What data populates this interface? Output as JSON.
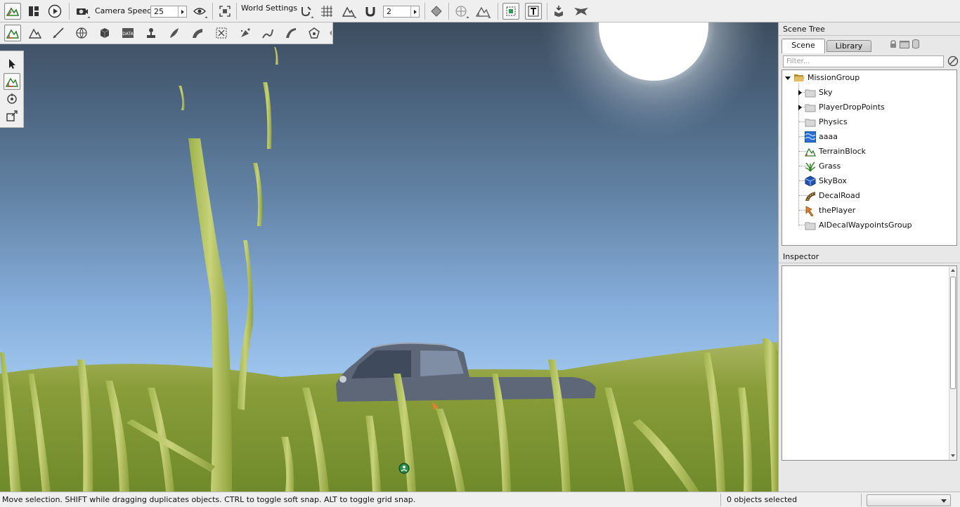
{
  "toolbar": {
    "camera_speed_label": "Camera Speed",
    "camera_speed_value": "25",
    "world_settings_label": "World Settings",
    "snap_value": "2",
    "buttons": [
      "editor-logo-icon",
      "layout-icon",
      "play-icon",
      "camera-icon",
      "visibility-eye-icon",
      "fit-view-icon",
      "snap-tool-icon",
      "grid-snap-icon",
      "terrain-snap-icon",
      "magnet-icon",
      "bounds-icon",
      "object-center-icon",
      "object-transform-icon",
      "select-box-icon",
      "text-label-icon",
      "drop-object-icon",
      "stamp-icon"
    ]
  },
  "editor_tools": [
    "world-editor-icon",
    "terrain-editor-icon",
    "terrain-painter-icon",
    "sketch-icon",
    "mesh-icon",
    "datablock-icon",
    "shape-editor-icon",
    "forest-editor-icon",
    "road-editor-icon",
    "decal-editor-icon",
    "particle-icon",
    "river-editor-icon",
    "mesh-road-icon",
    "convex-editor-icon"
  ],
  "palette": [
    "select-arrow-icon",
    "move-icon",
    "rotate-icon",
    "scale-icon"
  ],
  "scene_tree": {
    "title": "Scene Tree",
    "tabs": {
      "scene": "Scene",
      "library": "Library"
    },
    "filter_placeholder": "Filter...",
    "root": "MissionGroup",
    "items": [
      {
        "label": "Sky",
        "icon": "folder-icon",
        "expandable": true
      },
      {
        "label": "PlayerDropPoints",
        "icon": "folder-icon",
        "expandable": true
      },
      {
        "label": "Physics",
        "icon": "folder-icon",
        "expandable": false
      },
      {
        "label": "aaaa",
        "icon": "water-icon",
        "expandable": false
      },
      {
        "label": "TerrainBlock",
        "icon": "terrain-icon",
        "expandable": false
      },
      {
        "label": "Grass",
        "icon": "grass-icon",
        "expandable": false
      },
      {
        "label": "SkyBox",
        "icon": "skybox-icon",
        "expandable": false
      },
      {
        "label": "DecalRoad",
        "icon": "road-icon",
        "expandable": false
      },
      {
        "label": "thePlayer",
        "icon": "player-icon",
        "expandable": false
      },
      {
        "label": "AIDecalWaypointsGroup",
        "icon": "folder-icon",
        "expandable": false
      }
    ]
  },
  "inspector": {
    "title": "Inspector"
  },
  "statusbar": {
    "hint": "Move selection.  SHIFT while dragging duplicates objects.  CTRL to toggle soft snap.  ALT to toggle grid snap.",
    "selection_count": "0 objects selected",
    "dropdown_value": ""
  },
  "colors": {
    "panel_bg": "#efefef",
    "sky_top": "#3d4d5f",
    "sky_bottom": "#a8cbe9",
    "grass": "#8fa83e",
    "accent_folder": "#c9a04d"
  }
}
